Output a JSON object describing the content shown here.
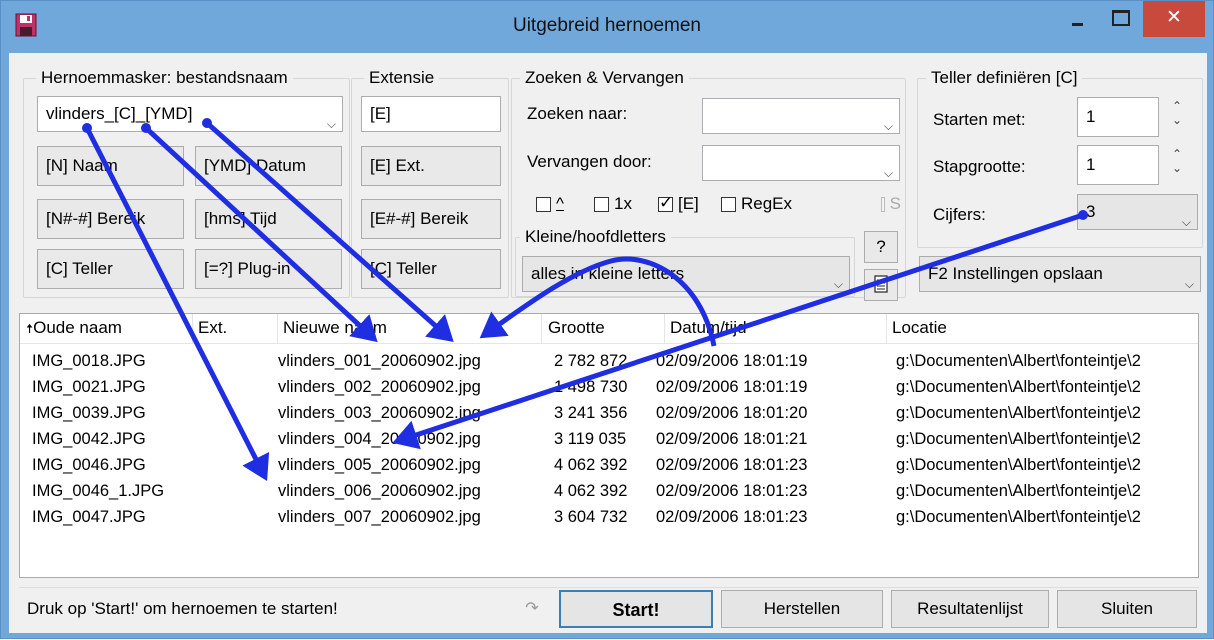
{
  "window": {
    "title": "Uitgebreid hernoemen",
    "close_glyph": "✕"
  },
  "mask": {
    "group_title": "Hernoemmasker: bestandsnaam",
    "value": "vlinders_[C]_[YMD]",
    "buttons": [
      "[N]  Naam",
      "[YMD]  Datum",
      "[N#-#] Bereik",
      "[hms]  Tijd",
      "[C]  Teller",
      "[=?]  Plug-in"
    ]
  },
  "extension": {
    "group_title": "Extensie",
    "value": "[E]",
    "buttons": [
      "[E]  Ext.",
      "[E#-#] Bereik",
      "[C]  Teller"
    ]
  },
  "search_replace": {
    "group_title": "Zoeken & Vervangen",
    "search_label": "Zoeken naar:",
    "search_value": "",
    "replace_label": "Vervangen door:",
    "replace_value": "",
    "options": [
      {
        "label": "^",
        "checked": false
      },
      {
        "label": "1x",
        "checked": false
      },
      {
        "label": "[E]",
        "checked": true
      },
      {
        "label": "RegEx",
        "checked": false
      }
    ],
    "extra_option_label": "S"
  },
  "case": {
    "group_title": "Kleine/hoofdletters",
    "value": "alles in kleine letters",
    "help_label": "?"
  },
  "counter": {
    "group_title": "Teller definiëren [C]",
    "start_label": "Starten met:",
    "start_value": "1",
    "step_label": "Stapgrootte:",
    "step_value": "1",
    "digits_label": "Cijfers:",
    "digits_value": "3"
  },
  "settings_combo": "F2 Instellingen opslaan",
  "list": {
    "columns": [
      "Oude naam",
      "Ext.",
      "Nieuwe naam",
      "Grootte",
      "Datum/tijd",
      "Locatie"
    ],
    "sort_indicator": "🠅",
    "rows": [
      {
        "old": "IMG_0018.JPG",
        "ext": "",
        "new": "vlinders_001_20060902.jpg",
        "size": "2 782 872",
        "date": "02/09/2006 18:01:19",
        "location": "g:\\Documenten\\Albert\\fonteintje\\2"
      },
      {
        "old": "IMG_0021.JPG",
        "ext": "",
        "new": "vlinders_002_20060902.jpg",
        "size": "1 498 730",
        "date": "02/09/2006 18:01:19",
        "location": "g:\\Documenten\\Albert\\fonteintje\\2"
      },
      {
        "old": "IMG_0039.JPG",
        "ext": "",
        "new": "vlinders_003_20060902.jpg",
        "size": "3 241 356",
        "date": "02/09/2006 18:01:20",
        "location": "g:\\Documenten\\Albert\\fonteintje\\2"
      },
      {
        "old": "IMG_0042.JPG",
        "ext": "",
        "new": "vlinders_004_20060902.jpg",
        "size": "3 119 035",
        "date": "02/09/2006 18:01:21",
        "location": "g:\\Documenten\\Albert\\fonteintje\\2"
      },
      {
        "old": "IMG_0046.JPG",
        "ext": "",
        "new": "vlinders_005_20060902.jpg",
        "size": "4 062 392",
        "date": "02/09/2006 18:01:23",
        "location": "g:\\Documenten\\Albert\\fonteintje\\2"
      },
      {
        "old": "IMG_0046_1.JPG",
        "ext": "",
        "new": "vlinders_006_20060902.jpg",
        "size": "4 062 392",
        "date": "02/09/2006 18:01:23",
        "location": "g:\\Documenten\\Albert\\fonteintje\\2"
      },
      {
        "old": "IMG_0047.JPG",
        "ext": "",
        "new": "vlinders_007_20060902.jpg",
        "size": "3 604 732",
        "date": "02/09/2006 18:01:23",
        "location": "g:\\Documenten\\Albert\\fonteintje\\2"
      }
    ]
  },
  "status": {
    "text": "Druk op 'Start!' om hernoemen te starten!",
    "refresh_glyph": "↷"
  },
  "buttons": {
    "start": "Start!",
    "restore": "Herstellen",
    "results": "Resultatenlijst",
    "close": "Sluiten"
  },
  "colors": {
    "titlebar": "#70a8dc",
    "close_button": "#c74a3d",
    "annotation_arrows": "#1f2ee0"
  },
  "icons": {
    "app": "floppy-disk-icon",
    "save_settings": "notepad-icon",
    "sort": "sort-ascending-arrow-icon",
    "refresh": "redo-icon"
  }
}
